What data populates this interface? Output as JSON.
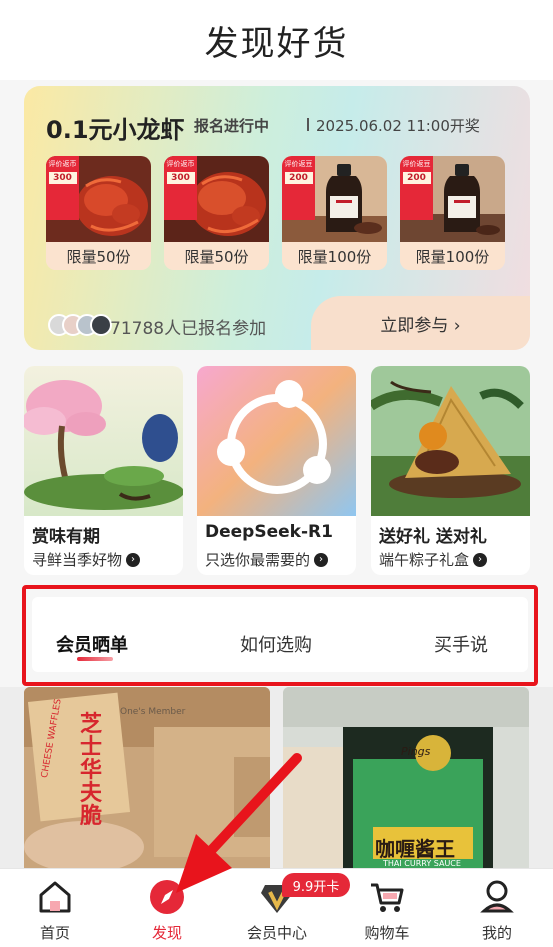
{
  "header": {
    "title": "发现好货"
  },
  "promo": {
    "title": "0.1元小龙虾",
    "status": "报名进行中",
    "time": "2025.06.02 11:00开奖",
    "products": [
      {
        "tag_title": "评价返币",
        "tag_amount": "300",
        "label": "限量50份",
        "icon": "crayfish-image"
      },
      {
        "tag_title": "评价返币",
        "tag_amount": "300",
        "label": "限量50份",
        "icon": "crayfish-image"
      },
      {
        "tag_title": "评价返豆",
        "tag_amount": "200",
        "label": "限量100份",
        "icon": "sauce-bottle-image"
      },
      {
        "tag_title": "评价返豆",
        "tag_amount": "200",
        "label": "限量100份",
        "icon": "sauce-bottle-image"
      }
    ],
    "participants_text": "71788人已报名参加",
    "join_button": "立即参与 ›"
  },
  "cards": [
    {
      "title": "赏味有期",
      "subtitle": "寻鲜当季好物"
    },
    {
      "title": "DeepSeek-R1",
      "subtitle": "只选你最需要的"
    },
    {
      "title": "送好礼 送对礼",
      "subtitle": "端午粽子礼盒"
    }
  ],
  "tabs": [
    {
      "label": "会员晒单",
      "active": true
    },
    {
      "label": "如何选购",
      "active": false
    },
    {
      "label": "买手说",
      "active": false
    }
  ],
  "feed": {
    "left_text": "芝士华夫脆",
    "left_sub": "CHEESE WAFFLES",
    "left_brand": "One's Member",
    "right_brand": "Pings",
    "right_title": "咖喱酱王",
    "right_sub": "THAI CURRY SAUCE"
  },
  "tabbar": {
    "items": [
      {
        "label": "首页",
        "icon": "home-icon",
        "active": false
      },
      {
        "label": "发现",
        "icon": "compass-icon",
        "active": true
      },
      {
        "label": "会员中心",
        "icon": "vip-icon",
        "active": false
      },
      {
        "label": "购物车",
        "icon": "cart-icon",
        "active": false
      },
      {
        "label": "我的",
        "icon": "profile-icon",
        "active": false
      }
    ],
    "badge": "9.9开卡"
  },
  "colors": {
    "accent": "#e52838",
    "highlight_box": "#e8141c"
  }
}
